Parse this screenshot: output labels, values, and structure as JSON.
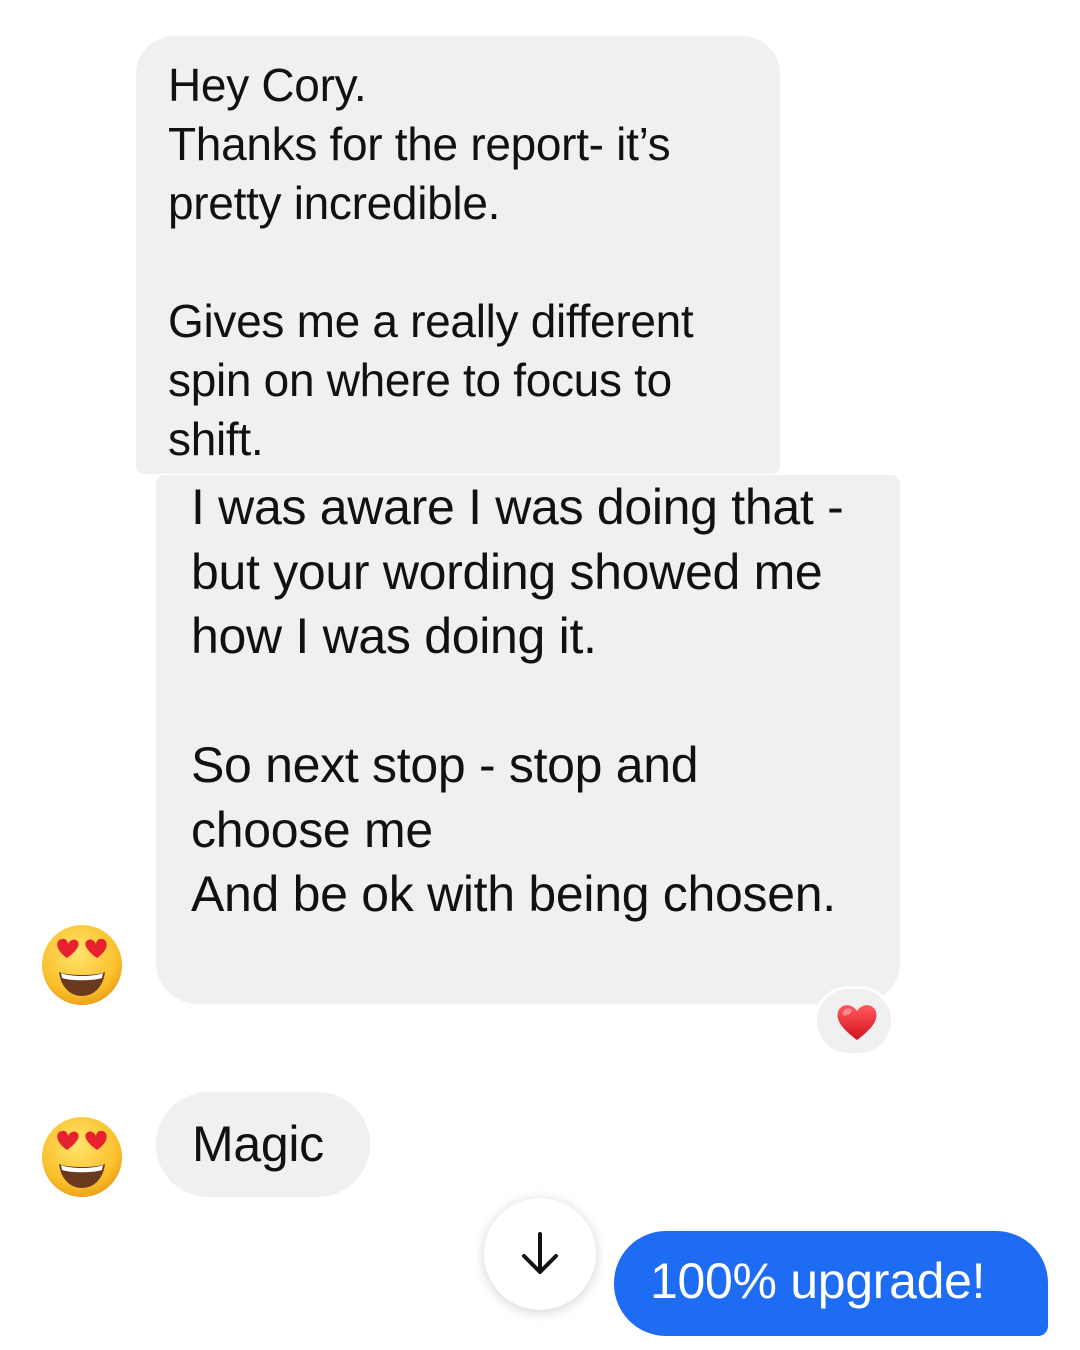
{
  "messages": [
    {
      "sender": "them",
      "text": "Hey Cory.\nThanks for the report- it’s pretty incredible.\n\nGives me a really different spin on where to focus to shift."
    },
    {
      "sender": "them",
      "text": "I was aware I was doing that - but your wording showed me how I was doing it.\n\nSo next stop - stop and choose me\nAnd be ok with being chosen.",
      "reaction": "heart-emoji"
    },
    {
      "sender": "them",
      "text": "Magic"
    },
    {
      "sender": "me",
      "text": "100% upgrade!"
    }
  ],
  "icons": {
    "avatar": "heart-eyes-emoji",
    "reaction": "heart-emoji",
    "scroll": "arrow-down-icon"
  },
  "colors": {
    "incoming_bubble": "#f0f0f0",
    "outgoing_bubble": "#1e6cf4",
    "reaction_heart": "#e8212f"
  }
}
